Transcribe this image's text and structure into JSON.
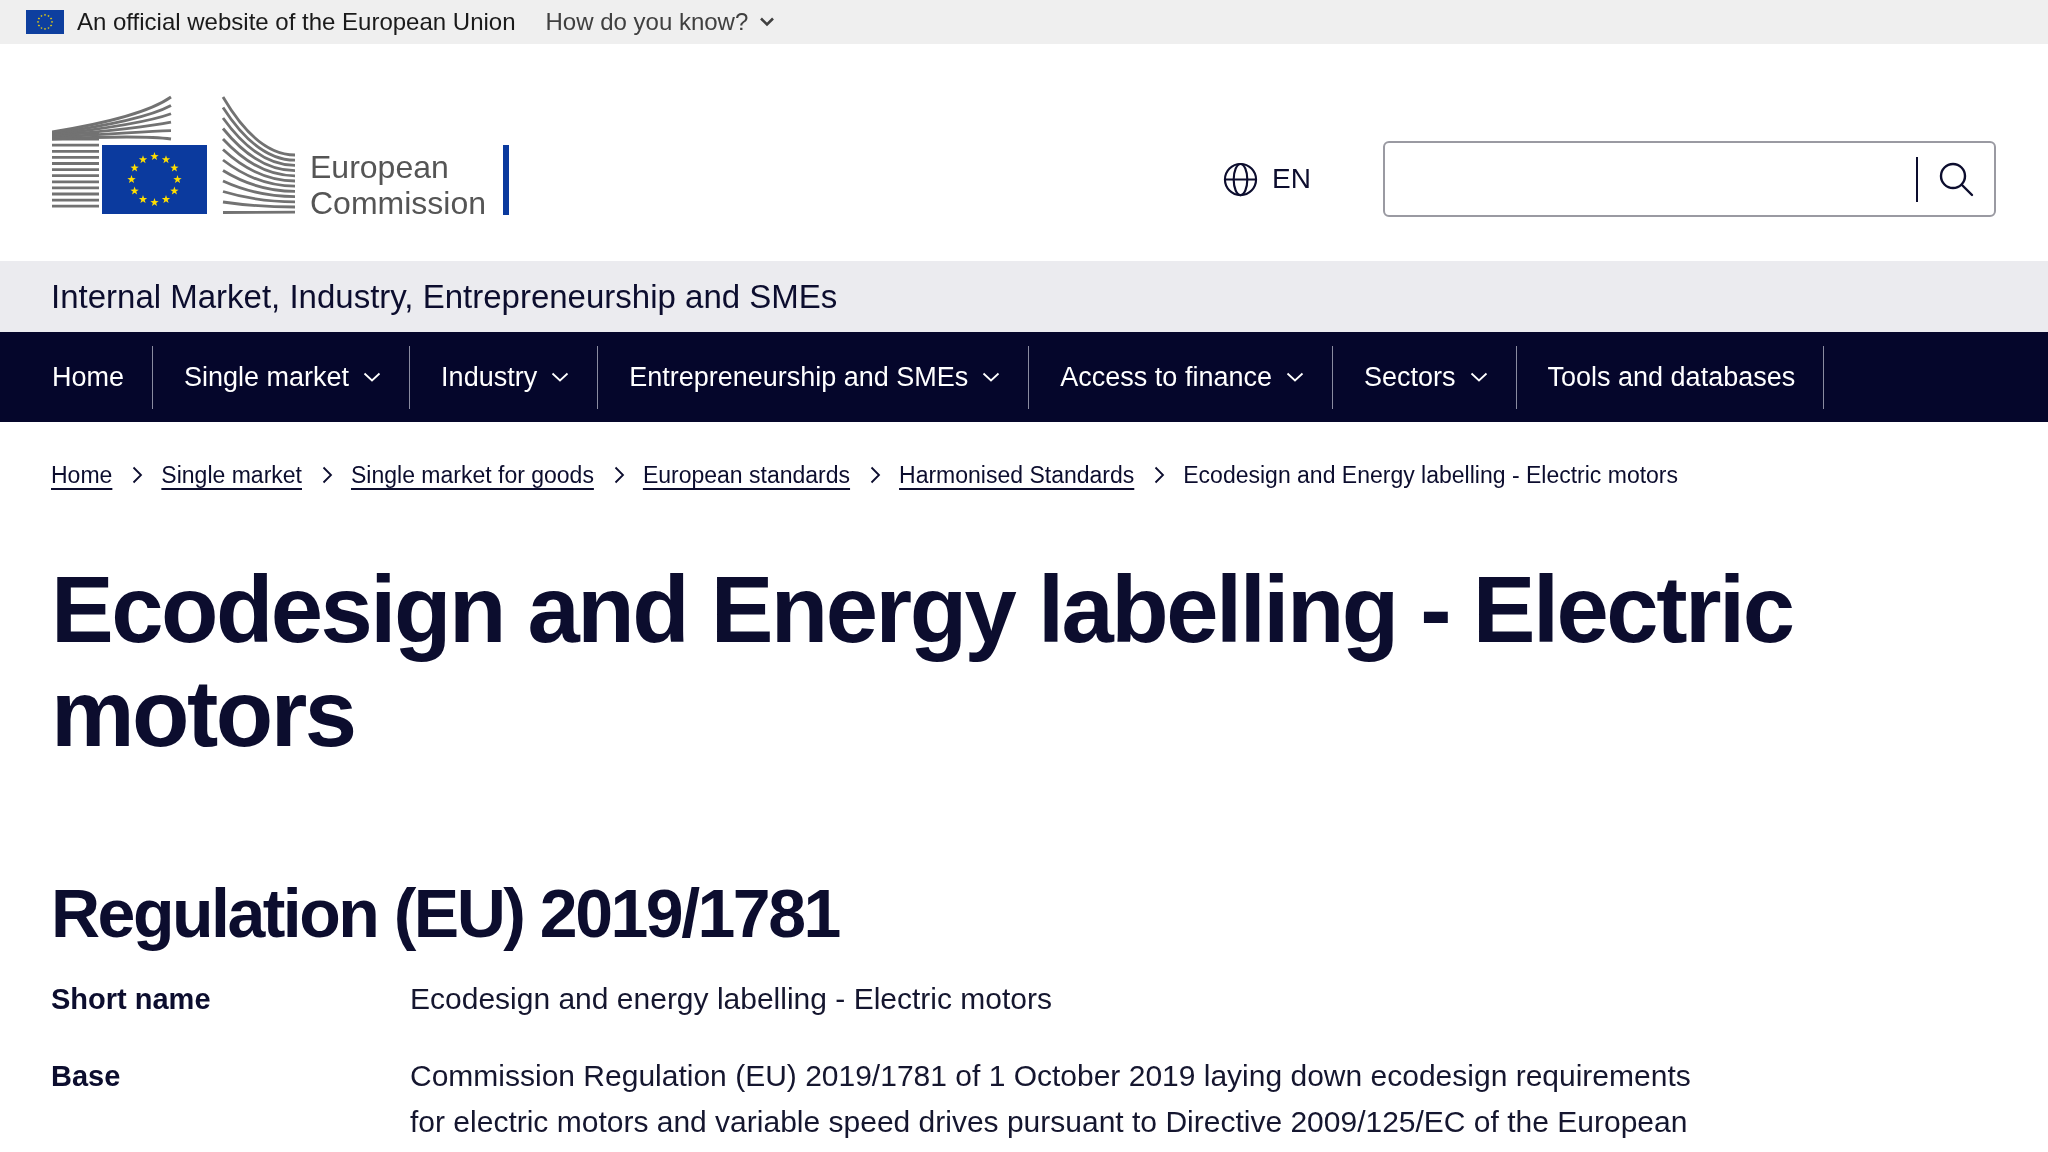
{
  "official_banner": {
    "text": "An official website of the European Union",
    "how_link": {
      "label": "How do you know?",
      "expanded": false
    }
  },
  "header": {
    "logo_text": "European Commission",
    "language": "EN"
  },
  "site_name": "Internal Market, Industry, Entrepreneurship and SMEs",
  "nav": [
    {
      "label": "Home",
      "dropdown": false
    },
    {
      "label": "Single market",
      "dropdown": true
    },
    {
      "label": "Industry",
      "dropdown": true
    },
    {
      "label": "Entrepreneurship and SMEs",
      "dropdown": true
    },
    {
      "label": "Access to finance",
      "dropdown": true
    },
    {
      "label": "Sectors",
      "dropdown": true
    },
    {
      "label": "Tools and databases",
      "dropdown": false
    }
  ],
  "breadcrumb": [
    {
      "label": "Home",
      "current": false
    },
    {
      "label": "Single market",
      "current": false
    },
    {
      "label": "Single market for goods",
      "current": false
    },
    {
      "label": "European standards",
      "current": false
    },
    {
      "label": "Harmonised Standards",
      "current": false
    },
    {
      "label": "Ecodesign and Energy labelling - Electric motors",
      "current": true
    }
  ],
  "page": {
    "title": "Ecodesign and Energy labelling - Electric motors",
    "section_title": "Regulation (EU) 2019/1781",
    "details": [
      {
        "term": "Short name",
        "value": "Ecodesign and energy labelling - Electric motors"
      },
      {
        "term": "Base",
        "value": "Commission Regulation (EU) 2019/1781 of 1 October 2019 laying down ecodesign requirements for electric motors and variable speed drives pursuant to Directive 2009/125/EC of the European"
      }
    ]
  }
}
